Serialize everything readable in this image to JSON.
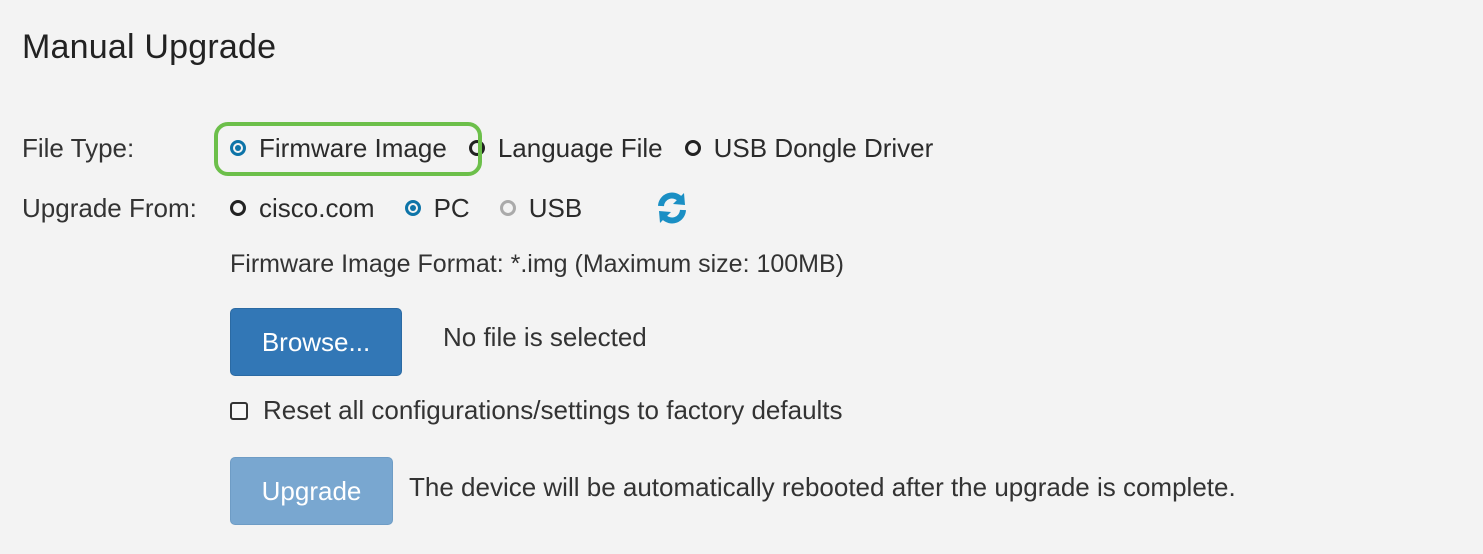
{
  "page": {
    "title": "Manual Upgrade"
  },
  "file_type": {
    "label": "File Type:",
    "options": [
      {
        "label": "Firmware Image",
        "checked": true,
        "disabled": false
      },
      {
        "label": "Language File",
        "checked": false,
        "disabled": false
      },
      {
        "label": "USB Dongle Driver",
        "checked": false,
        "disabled": false
      }
    ],
    "highlighted_option": "Firmware Image"
  },
  "upgrade_from": {
    "label": "Upgrade From:",
    "options": [
      {
        "label": "cisco.com",
        "checked": false,
        "disabled": false
      },
      {
        "label": "PC",
        "checked": true,
        "disabled": false
      },
      {
        "label": "USB",
        "checked": false,
        "disabled": true
      }
    ],
    "refresh_icon": "refresh-icon"
  },
  "format_info": "Firmware Image Format: *.img (Maximum size: 100MB)",
  "browse": {
    "label": "Browse...",
    "file_status": "No file is selected"
  },
  "reset_option": {
    "label": "Reset all configurations/settings to factory defaults",
    "checked": false
  },
  "upgrade": {
    "label": "Upgrade",
    "enabled": false,
    "note": "The device will be automatically rebooted after the upgrade is complete."
  },
  "colors": {
    "accent": "#0d74a8",
    "highlight": "#6cbf4a",
    "primary_button": "#3277b6",
    "disabled_button": "#79a7d0",
    "background": "#f3f3f3"
  }
}
